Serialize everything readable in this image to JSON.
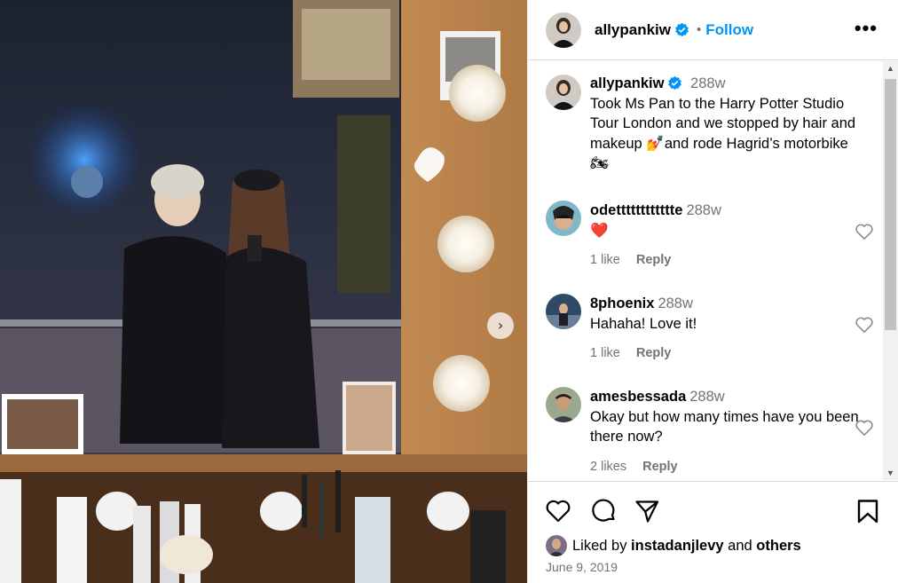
{
  "header": {
    "username": "allypankiw",
    "separator": "•",
    "follow_label": "Follow",
    "more_label": "•••"
  },
  "caption": {
    "username": "allypankiw",
    "time": "288w",
    "text": "Took Ms Pan to the Harry Potter Studio Tour London and we stopped by hair and makeup 💅and rode Hagrid’s motorbike 🏍"
  },
  "comments": [
    {
      "username": "odetttttttttttte",
      "time": "288w",
      "text": "❤️",
      "likes": "1 like",
      "reply": "Reply"
    },
    {
      "username": "8phoenix",
      "time": "288w",
      "text": "Hahaha! Love it!",
      "likes": "1 like",
      "reply": "Reply"
    },
    {
      "username": "amesbessada",
      "time": "288w",
      "text": "Okay but how many times have you been there now?",
      "likes": "2 likes",
      "reply": "Reply"
    }
  ],
  "liked_by": {
    "prefix": "Liked by ",
    "user": "instadanjlevy",
    "middle": " and ",
    "others": "others"
  },
  "date": "June 9, 2019",
  "media": {
    "next_label": "›"
  },
  "scroll": {
    "up": "▲",
    "down": "▼"
  },
  "icons": {
    "verified": "verified-badge-icon",
    "like": "heart-icon",
    "comment": "comment-icon",
    "share": "share-icon",
    "save": "bookmark-icon"
  },
  "colors": {
    "accent": "#0095f6",
    "muted": "#737373",
    "border": "#dbdbdb"
  }
}
